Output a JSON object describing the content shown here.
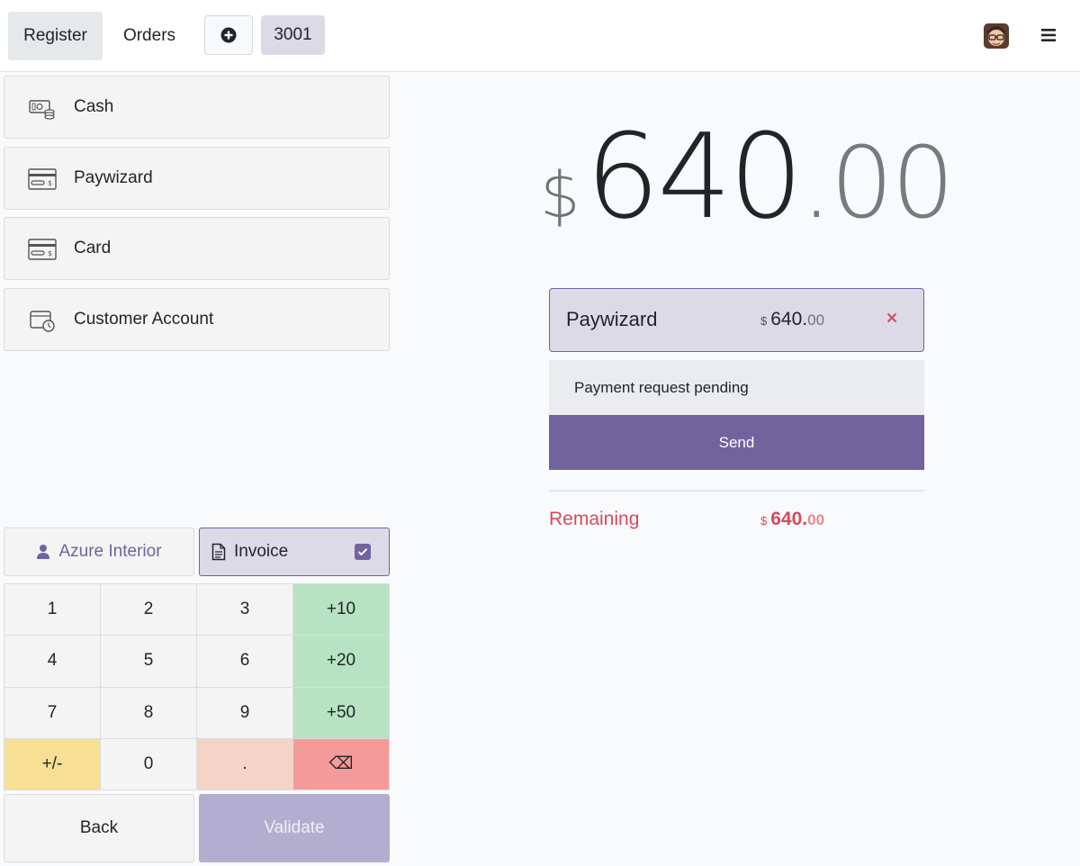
{
  "topbar": {
    "register_label": "Register",
    "orders_label": "Orders",
    "add_icon": "plus-circle-icon",
    "order_number": "3001",
    "avatar_icon": "user-avatar",
    "menu_icon": "hamburger-menu-icon"
  },
  "payment_methods": [
    {
      "label": "Cash",
      "icon": "cash-icon"
    },
    {
      "label": "Paywizard",
      "icon": "card-terminal-icon"
    },
    {
      "label": "Card",
      "icon": "card-terminal-icon"
    },
    {
      "label": "Customer Account",
      "icon": "wallet-clock-icon"
    }
  ],
  "customer": {
    "label": "Azure Interior",
    "icon": "user-icon"
  },
  "invoice": {
    "label": "Invoice",
    "checked": true,
    "icon": "file-icon"
  },
  "numpad": {
    "keys": [
      "1",
      "2",
      "3",
      "+10",
      "4",
      "5",
      "6",
      "+20",
      "7",
      "8",
      "9",
      "+50",
      "+/-",
      "0",
      ".",
      "⌫"
    ]
  },
  "actions": {
    "back_label": "Back",
    "validate_label": "Validate"
  },
  "total": {
    "currency": "$",
    "integer": "640",
    "decimal": ".00"
  },
  "payment_line": {
    "name": "Paywizard",
    "currency": "$",
    "integer": "640.",
    "decimal": "00",
    "remove_icon": "close-x-icon"
  },
  "status": {
    "pending_text": "Payment request pending",
    "send_label": "Send"
  },
  "remaining": {
    "label": "Remaining",
    "currency": "$",
    "integer": "640.",
    "decimal": "00"
  },
  "colors": {
    "accent": "#71639e",
    "accent_light": "#dcdae6",
    "danger": "#d44c59",
    "plus_keys": "#b8e3c2",
    "sign_key": "#f7e093",
    "dot_key": "#f4d4c7",
    "backspace_key": "#f59a9a"
  }
}
